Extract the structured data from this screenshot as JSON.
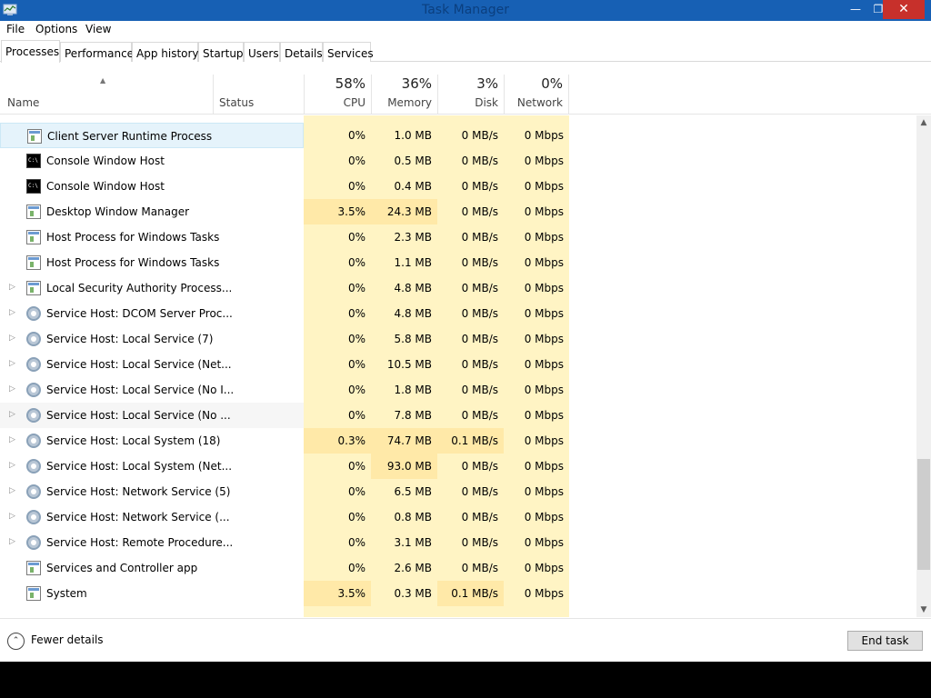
{
  "window": {
    "title": "Task Manager"
  },
  "menu": [
    "File",
    "Options",
    "View"
  ],
  "tabs": [
    "Processes",
    "Performance",
    "App history",
    "Startup",
    "Users",
    "Details",
    "Services"
  ],
  "header": {
    "name": "Name",
    "status": "Status",
    "cpu": {
      "pct": "58%",
      "label": "CPU"
    },
    "memory": {
      "pct": "36%",
      "label": "Memory"
    },
    "disk": {
      "pct": "3%",
      "label": "Disk"
    },
    "network": {
      "pct": "0%",
      "label": "Network"
    }
  },
  "rows": [
    {
      "name": "Client Server Runtime Process",
      "icon": "window-icon",
      "expand": false,
      "cpu": "0%",
      "mem": "1.0 MB",
      "disk": "0 MB/s",
      "net": "0 Mbps"
    },
    {
      "name": "Console Window Host",
      "icon": "console-icon",
      "expand": false,
      "cpu": "0%",
      "mem": "0.5 MB",
      "disk": "0 MB/s",
      "net": "0 Mbps"
    },
    {
      "name": "Console Window Host",
      "icon": "console-icon",
      "expand": false,
      "cpu": "0%",
      "mem": "0.4 MB",
      "disk": "0 MB/s",
      "net": "0 Mbps"
    },
    {
      "name": "Desktop Window Manager",
      "icon": "window-icon",
      "expand": false,
      "cpu": "3.5%",
      "mem": "24.3 MB",
      "disk": "0 MB/s",
      "net": "0 Mbps"
    },
    {
      "name": "Host Process for Windows Tasks",
      "icon": "window-icon",
      "expand": false,
      "cpu": "0%",
      "mem": "2.3 MB",
      "disk": "0 MB/s",
      "net": "0 Mbps"
    },
    {
      "name": "Host Process for Windows Tasks",
      "icon": "window-icon",
      "expand": false,
      "cpu": "0%",
      "mem": "1.1 MB",
      "disk": "0 MB/s",
      "net": "0 Mbps"
    },
    {
      "name": "Local Security Authority Process...",
      "icon": "window-icon",
      "expand": true,
      "cpu": "0%",
      "mem": "4.8 MB",
      "disk": "0 MB/s",
      "net": "0 Mbps"
    },
    {
      "name": "Service Host: DCOM Server Proc...",
      "icon": "gear-icon",
      "expand": true,
      "cpu": "0%",
      "mem": "4.8 MB",
      "disk": "0 MB/s",
      "net": "0 Mbps"
    },
    {
      "name": "Service Host: Local Service (7)",
      "icon": "gear-icon",
      "expand": true,
      "cpu": "0%",
      "mem": "5.8 MB",
      "disk": "0 MB/s",
      "net": "0 Mbps"
    },
    {
      "name": "Service Host: Local Service (Net...",
      "icon": "gear-icon",
      "expand": true,
      "cpu": "0%",
      "mem": "10.5 MB",
      "disk": "0 MB/s",
      "net": "0 Mbps"
    },
    {
      "name": "Service Host: Local Service (No I...",
      "icon": "gear-icon",
      "expand": true,
      "cpu": "0%",
      "mem": "1.8 MB",
      "disk": "0 MB/s",
      "net": "0 Mbps"
    },
    {
      "name": "Service Host: Local Service (No ...",
      "icon": "gear-icon",
      "expand": true,
      "cpu": "0%",
      "mem": "7.8 MB",
      "disk": "0 MB/s",
      "net": "0 Mbps"
    },
    {
      "name": "Service Host: Local System (18)",
      "icon": "gear-icon",
      "expand": true,
      "cpu": "0.3%",
      "mem": "74.7 MB",
      "disk": "0.1 MB/s",
      "net": "0 Mbps"
    },
    {
      "name": "Service Host: Local System (Net...",
      "icon": "gear-icon",
      "expand": true,
      "cpu": "0%",
      "mem": "93.0 MB",
      "disk": "0 MB/s",
      "net": "0 Mbps"
    },
    {
      "name": "Service Host: Network Service (5)",
      "icon": "gear-icon",
      "expand": true,
      "cpu": "0%",
      "mem": "6.5 MB",
      "disk": "0 MB/s",
      "net": "0 Mbps"
    },
    {
      "name": "Service Host: Network Service (...",
      "icon": "gear-icon",
      "expand": true,
      "cpu": "0%",
      "mem": "0.8 MB",
      "disk": "0 MB/s",
      "net": "0 Mbps"
    },
    {
      "name": "Service Host: Remote Procedure...",
      "icon": "gear-icon",
      "expand": true,
      "cpu": "0%",
      "mem": "3.1 MB",
      "disk": "0 MB/s",
      "net": "0 Mbps"
    },
    {
      "name": "Services and Controller app",
      "icon": "window-icon",
      "expand": false,
      "cpu": "0%",
      "mem": "2.6 MB",
      "disk": "0 MB/s",
      "net": "0 Mbps"
    },
    {
      "name": "System",
      "icon": "window-icon",
      "expand": false,
      "cpu": "3.5%",
      "mem": "0.3 MB",
      "disk": "0.1 MB/s",
      "net": "0 Mbps"
    }
  ],
  "footer": {
    "fewer_details": "Fewer details",
    "end_task": "End task"
  }
}
